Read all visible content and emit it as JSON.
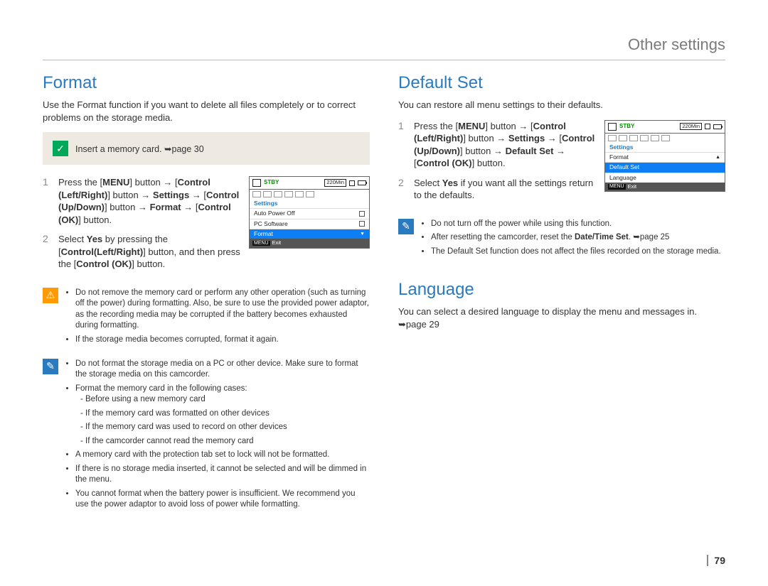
{
  "header": "Other settings",
  "pageNumber": "79",
  "left": {
    "format_title": "Format",
    "format_lead": "Use the Format function if you want to delete all files completely or to correct problems on the storage media.",
    "infobox": "Insert a memory card. ➥page 30",
    "steps": {
      "s1": {
        "num": "1",
        "text_parts": [
          "Press the [",
          "MENU",
          "] button → [",
          "Control (Left/Right)",
          "] button → ",
          "Settings",
          " → [",
          "Control (Up/Down)",
          "] button → ",
          "Format",
          " → [",
          "Control (OK)",
          "] button."
        ]
      },
      "s2": {
        "num": "2",
        "text_parts": [
          "Select ",
          "Yes",
          " by pressing the [",
          "Control(Left/Right)",
          "] button, and then press the [",
          "Control (OK)",
          "] button."
        ]
      }
    },
    "lcd": {
      "stby": "STBY",
      "time": "220Min",
      "category": "Settings",
      "items": [
        "Auto Power Off",
        "PC Software",
        "Format"
      ],
      "selected": "Format",
      "exit_label": "MENU",
      "exit_text": "Exit"
    },
    "warn1_items": [
      "Do not remove the memory card or perform any other operation (such as turning off the power) during formatting. Also, be sure to use the provided power adaptor, as the recording media may be corrupted if the battery becomes exhausted during formatting.",
      "If the storage media becomes corrupted, format it again."
    ],
    "tips_items": [
      "Do not format the storage media on a PC or other device. Make sure to format the storage media on this camcorder.",
      "Format the memory card in the following cases:",
      "A memory card with the protection tab set to lock will not be formatted.",
      "If there is no storage media inserted, it cannot be selected and will be dimmed in the menu.",
      "You cannot format when the battery power is insufficient. We recommend you use the power adaptor to avoid loss of power while formatting."
    ],
    "tips_sub": [
      "Before using a new memory card",
      "If the memory card was formatted on other devices",
      "If the memory card was used to record on other devices",
      "If the camcorder cannot read the memory card"
    ]
  },
  "right": {
    "defaultset_title": "Default Set",
    "defaultset_lead": "You can restore all menu settings to their defaults.",
    "steps": {
      "s1": {
        "num": "1",
        "text_parts": [
          "Press the [",
          "MENU",
          "] button → [",
          "Control (Left/Right)",
          "] button → ",
          "Settings",
          " → [",
          "Control (Up/Down)",
          "] button → ",
          "Default Set",
          " → [",
          "Control (OK)",
          "] button."
        ]
      },
      "s2": {
        "num": "2",
        "text_parts": [
          "Select ",
          "Yes",
          " if you want all the settings return to the defaults."
        ]
      }
    },
    "lcd": {
      "stby": "STBY",
      "time": "220Min",
      "category": "Settings",
      "items": [
        "Format",
        "Default Set",
        "Language"
      ],
      "selected": "Default Set",
      "exit_label": "MENU",
      "exit_text": "Exit"
    },
    "tips_items": [
      "Do not turn off the power while using this function.",
      "After resetting the camcorder, reset the Date/Time Set. ➥page 25",
      "The Default Set function does not affect the files recorded on the storage media."
    ],
    "language_title": "Language",
    "language_lead": "You can select a desired language to display the menu and messages in. ➥page 29"
  }
}
